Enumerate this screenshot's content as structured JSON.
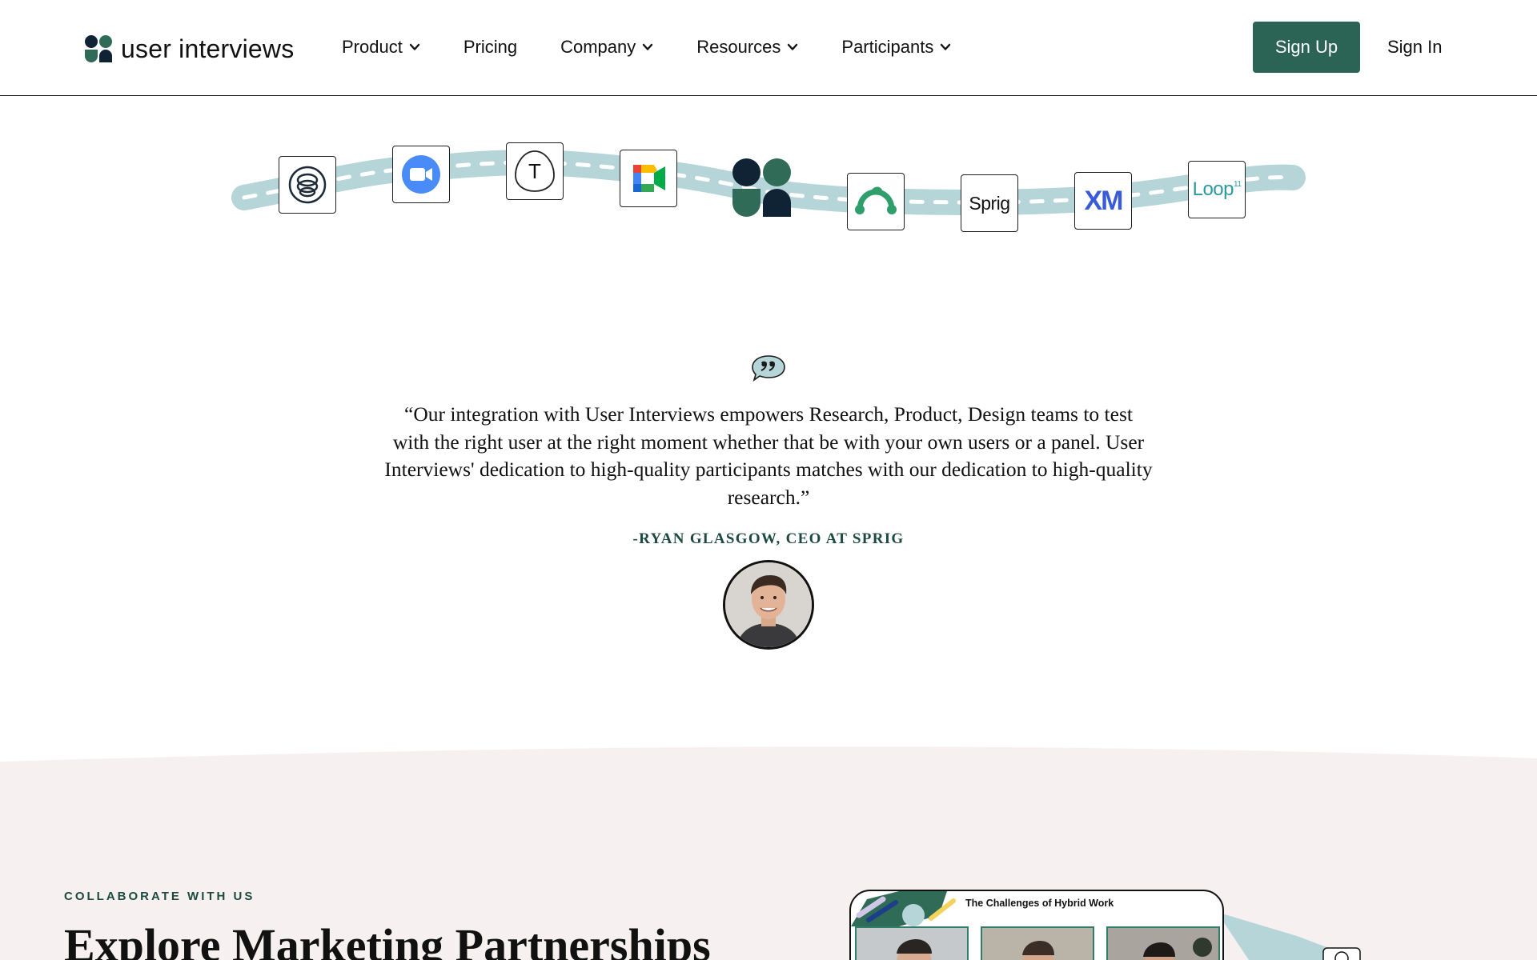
{
  "brand": {
    "name": "user interviews",
    "colors": {
      "primary": "#2b6455",
      "dark": "#0f2335",
      "road": "#b5d5d8",
      "section_bg": "#f6f1f0"
    }
  },
  "nav": {
    "items": [
      {
        "label": "Product",
        "dropdown": true
      },
      {
        "label": "Pricing",
        "dropdown": false
      },
      {
        "label": "Company",
        "dropdown": true
      },
      {
        "label": "Resources",
        "dropdown": true
      },
      {
        "label": "Participants",
        "dropdown": true
      }
    ],
    "signup_label": "Sign Up",
    "signin_label": "Sign In"
  },
  "integrations": {
    "icons": [
      "spiral-logo-icon",
      "zoom-icon",
      "typeform-icon",
      "google-meet-icon",
      "user-interviews-icon",
      "surveymonkey-icon",
      "sprig-icon",
      "qualtrics-xm-icon",
      "loop11-icon"
    ],
    "sprig_text": "Sprig",
    "xm_text": "XM",
    "loop_text": "Loop",
    "loop_sup": "11",
    "typeform_text": "T"
  },
  "testimonial": {
    "quote": "“Our integration with User Interviews empowers Research, Product, Design teams to test with the right user at the right moment whether that be with your own users or a panel. User Interviews' dedication to high-quality participants matches with our dedication to high-quality research.”",
    "author": "-RYAN GLASGOW, CEO AT SPRIG"
  },
  "collaborate": {
    "kicker": "COLLABORATE WITH US",
    "heading": "Explore Marketing Partnerships",
    "card_title": "The Challenges of Hybrid Work"
  }
}
